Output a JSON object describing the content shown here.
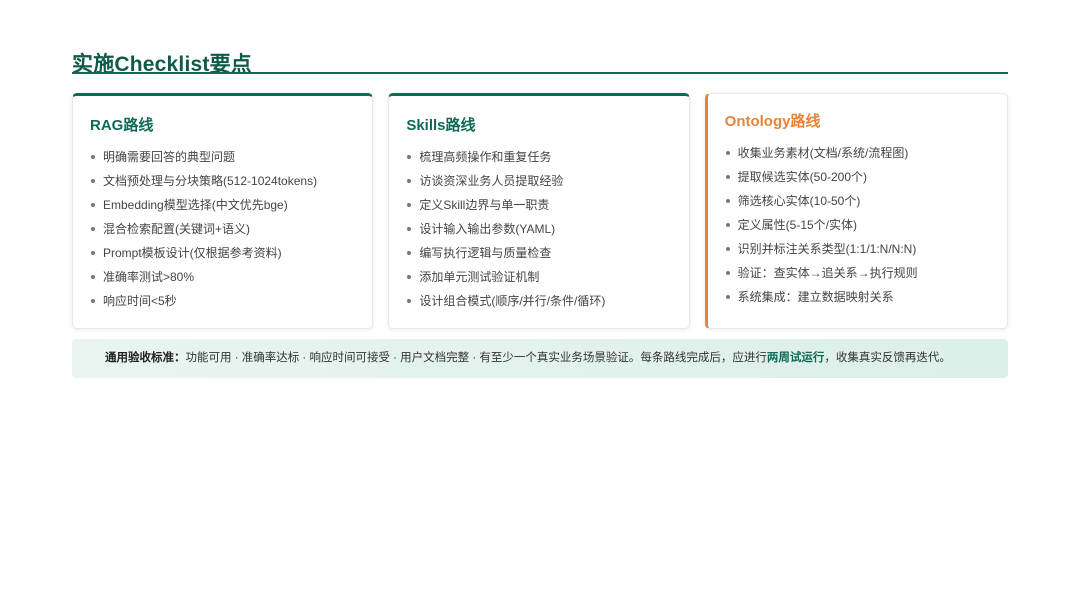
{
  "title": "实施Checklist要点",
  "cards": [
    {
      "title": "RAG路线",
      "items": [
        "明确需要回答的典型问题",
        "文档预处理与分块策略(512-1024tokens)",
        "Embedding模型选择(中文优先bge)",
        "混合检索配置(关键词+语义)",
        "Prompt模板设计(仅根据参考资料)",
        "准确率测试>80%",
        "响应时间<5秒"
      ]
    },
    {
      "title": "Skills路线",
      "items": [
        "梳理高频操作和重复任务",
        "访谈资深业务人员提取经验",
        "定义Skill边界与单一职责",
        "设计输入输出参数(YAML)",
        "编写执行逻辑与质量检查",
        "添加单元测试验证机制",
        "设计组合模式(顺序/并行/条件/循环)"
      ]
    },
    {
      "title": "Ontology路线",
      "items": [
        "收集业务素材(文档/系统/流程图)",
        "提取候选实体(50-200个)",
        "筛选核心实体(10-50个)",
        "定义属性(5-15个/实体)",
        "识别并标注关系类型(1:1/1:N/N:N)",
        "验证：查实体→追关系→执行规则",
        "系统集成：建立数据映射关系"
      ]
    }
  ],
  "criteria": {
    "label": "通用验收标准：",
    "text_before": "功能可用 · 准确率达标 · 响应时间可接受 · 用户文档完整 · 有至少一个真实业务场景验证。每条路线完成后，应进行",
    "highlight": "两周试运行",
    "text_after": "，收集真实反馈再迭代。"
  },
  "colors": {
    "primary": "#0f6b57",
    "accent": "#e8843a",
    "banner_bg": "#e2f1ed"
  }
}
